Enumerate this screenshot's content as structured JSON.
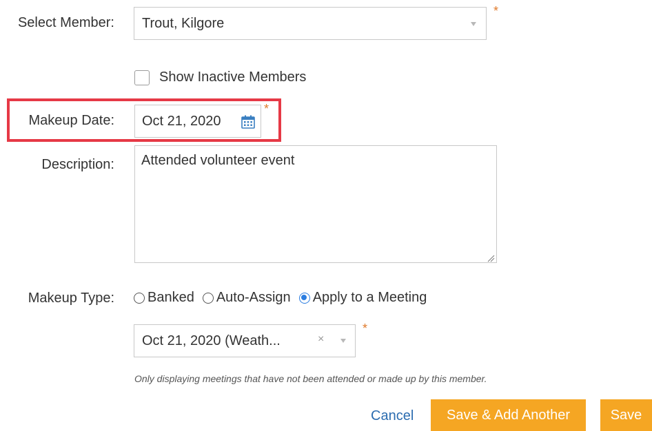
{
  "form": {
    "select_member": {
      "label": "Select Member:",
      "value": "Trout, Kilgore",
      "required_mark": "*"
    },
    "show_inactive": {
      "label": "Show Inactive Members",
      "checked": false
    },
    "makeup_date": {
      "label": "Makeup Date:",
      "value": "Oct 21, 2020",
      "required_mark": "*"
    },
    "description": {
      "label": "Description:",
      "value": "Attended volunteer event"
    },
    "makeup_type": {
      "label": "Makeup Type:",
      "options": [
        "Banked",
        "Auto-Assign",
        "Apply to a Meeting"
      ],
      "selected": "Apply to a Meeting"
    },
    "meeting_select": {
      "value": "Oct 21, 2020 (Weath...",
      "clear_symbol": "×",
      "required_mark": "*"
    },
    "hint": "Only displaying meetings that have not been attended or made up by this member."
  },
  "actions": {
    "cancel_label": "Cancel",
    "save_add_label": "Save & Add Another",
    "save_label": "Save"
  },
  "colors": {
    "accent_orange": "#f5a623",
    "link_blue": "#2b6cb0",
    "highlight_red": "#e63946",
    "required_orange": "#e07a2b"
  }
}
